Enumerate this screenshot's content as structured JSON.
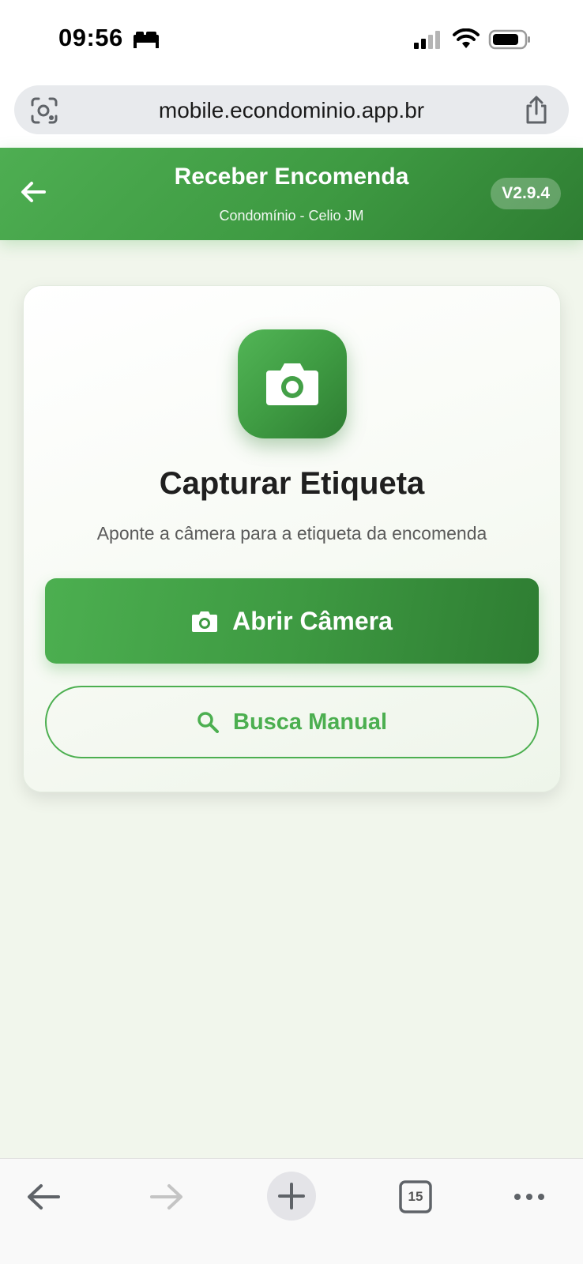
{
  "status_bar": {
    "time": "09:56"
  },
  "browser": {
    "url": "mobile.econdominio.app.br",
    "tab_count": "15"
  },
  "header": {
    "title": "Receber Encomenda",
    "subtitle": "Condomínio - Celio JM",
    "version": "V2.9.4"
  },
  "card": {
    "title": "Capturar Etiqueta",
    "description": "Aponte a câmera para a etiqueta da encomenda",
    "open_camera_label": "Abrir Câmera",
    "manual_search_label": "Busca Manual"
  },
  "colors": {
    "primary": "#4caf50",
    "primary_dark": "#2e7d32",
    "background": "#f1f6ec"
  },
  "icons": {
    "status": [
      "bed-icon",
      "signal-icon",
      "wifi-icon",
      "battery-icon"
    ],
    "url_bar": [
      "lens-icon",
      "share-icon"
    ],
    "header": [
      "arrow-left-icon"
    ],
    "card": [
      "camera-icon",
      "search-icon"
    ],
    "toolbar": [
      "arrow-left-icon",
      "arrow-right-icon",
      "plus-icon",
      "tabs-icon",
      "more-icon"
    ]
  }
}
